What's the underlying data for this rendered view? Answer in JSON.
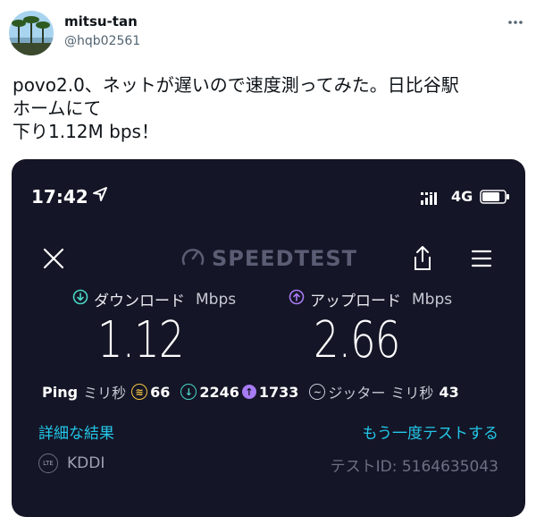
{
  "user": {
    "name": "mitsu-tan",
    "handle": "@hqb02561"
  },
  "tweet_text": "povo2.0、ネットが遅いので速度測ってみた。日比谷駅\nホームにて\n下り1.12M bps！",
  "phone": {
    "time": "17:42",
    "network": "4G"
  },
  "speedtest": {
    "logo": "SPEEDTEST",
    "download_label": "ダウンロード",
    "upload_label": "アップロード",
    "unit": "Mbps",
    "download_value": "1.12",
    "upload_value": "2.66",
    "ping_label": "Ping",
    "ping_unit": "ミリ秒",
    "ping_value": "66",
    "ping_down": "2246",
    "ping_up": "1733",
    "jitter_label": "ジッター",
    "jitter_unit": "ミリ秒",
    "jitter_value": "43",
    "details_link": "詳細な結果",
    "retest_link": "もう一度テストする",
    "isp_badge": "LTE",
    "isp": "KDDI",
    "test_id": "テストID: 5164635043"
  },
  "icons": {
    "more": "more-icon",
    "location": "location-arrow-icon",
    "signal": "signal-icon",
    "battery": "battery-icon",
    "close": "close-icon",
    "gauge": "gauge-icon",
    "share": "share-icon",
    "menu": "menu-icon",
    "download": "download-icon",
    "upload": "upload-icon",
    "ping": "ping-icon",
    "jitter": "jitter-icon"
  },
  "colors": {
    "panel_bg": "#141526",
    "download": "#4ad6c5",
    "upload": "#a77bf3",
    "ping": "#f4c542",
    "link": "#23c7e8"
  }
}
